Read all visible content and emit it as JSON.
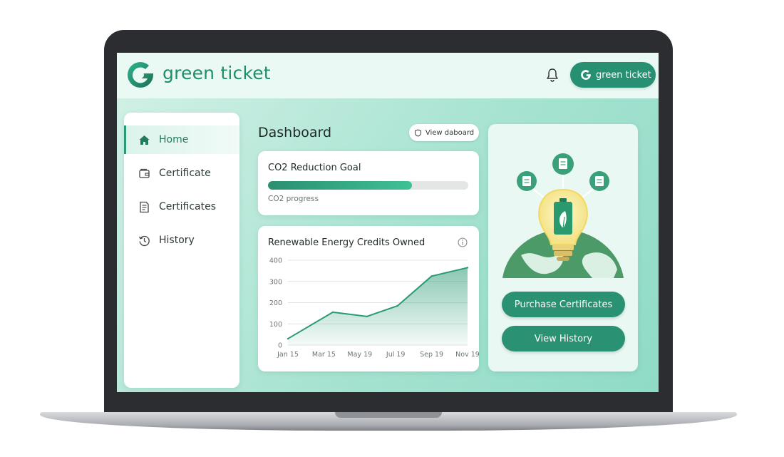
{
  "app": {
    "brand_name": "green ticket"
  },
  "header": {
    "account_button_label": "green ticket"
  },
  "sidebar": {
    "items": [
      {
        "label": "Home",
        "icon": "home-icon",
        "active": true
      },
      {
        "label": "Certificate",
        "icon": "wallet-icon",
        "active": false
      },
      {
        "label": "Certificates",
        "icon": "document-icon",
        "active": false
      },
      {
        "label": "History",
        "icon": "history-icon",
        "active": false
      }
    ]
  },
  "main": {
    "title": "Dashboard",
    "view_board_label": "View daboard",
    "goal_card": {
      "title": "CO2 Reduction Goal",
      "progress": 0.72,
      "subtitle": "CO2 progress"
    },
    "chart_card": {
      "title": "Renewable Energy Credits Owned"
    }
  },
  "promo": {
    "purchase_label": "Purchase Certificates",
    "history_label": "View History"
  },
  "colors": {
    "accent": "#279072",
    "accent_light": "#3fc096",
    "background": "#a7e3d1"
  },
  "chart_data": {
    "type": "area",
    "title": "Renewable Energy Credits Owned",
    "xlabel": "",
    "ylabel": "",
    "categories": [
      "Jan 15",
      "Mar 15",
      "May 19",
      "Jul 19",
      "Sep 19",
      "Nov 19"
    ],
    "x": [
      0,
      1.25,
      2.2,
      3.05,
      4.0,
      5.0
    ],
    "values": [
      30,
      155,
      135,
      185,
      325,
      365
    ],
    "ylim": [
      0,
      400
    ],
    "yticks": [
      "0",
      "100",
      "200",
      "300",
      "400"
    ],
    "grid": true
  }
}
